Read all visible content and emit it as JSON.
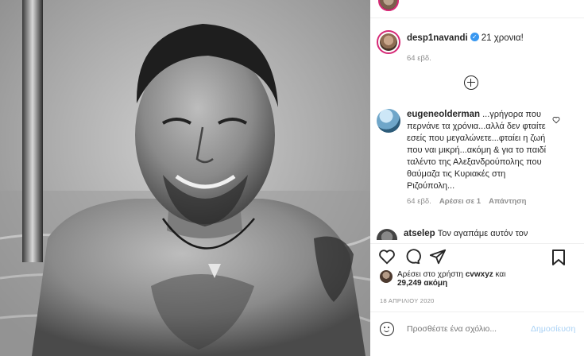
{
  "photo": {
    "alt": "Black and white photo of a smiling man in a swimming pool"
  },
  "caption": {
    "username": "desp1navandi",
    "text": "21 χρονια!",
    "time": "64 εβδ."
  },
  "comment": {
    "username": "eugeneolderman",
    "text": "...γρήγορα που περνάνε τα χρόνια...αλλά δεν φταίτε εσείς που μεγαλώνετε...φταίει η ζωή που ναι μικρή...ακόμη & για το παιδί ταλέντο της Αλεξανδρούπολης που θαύμαζα τις Κυριακές στη Ριζούπολη...",
    "time": "64 εβδ.",
    "likes": "Αρέσει σε 1",
    "reply": "Απάντηση"
  },
  "comment2": {
    "username": "atselep",
    "text": "Τον αγαπάμε αυτόν τον"
  },
  "likes": {
    "prefix": "Αρέσει στο χρήστη",
    "user": "cvwxyz",
    "and": "και",
    "count": "29,249 ακόμη"
  },
  "date": "18 ΑΠΡΙΛΙΟΥ 2020",
  "add_comment": {
    "placeholder": "Προσθέστε ένα σχόλιο...",
    "post_label": "Δημοσίευση"
  }
}
